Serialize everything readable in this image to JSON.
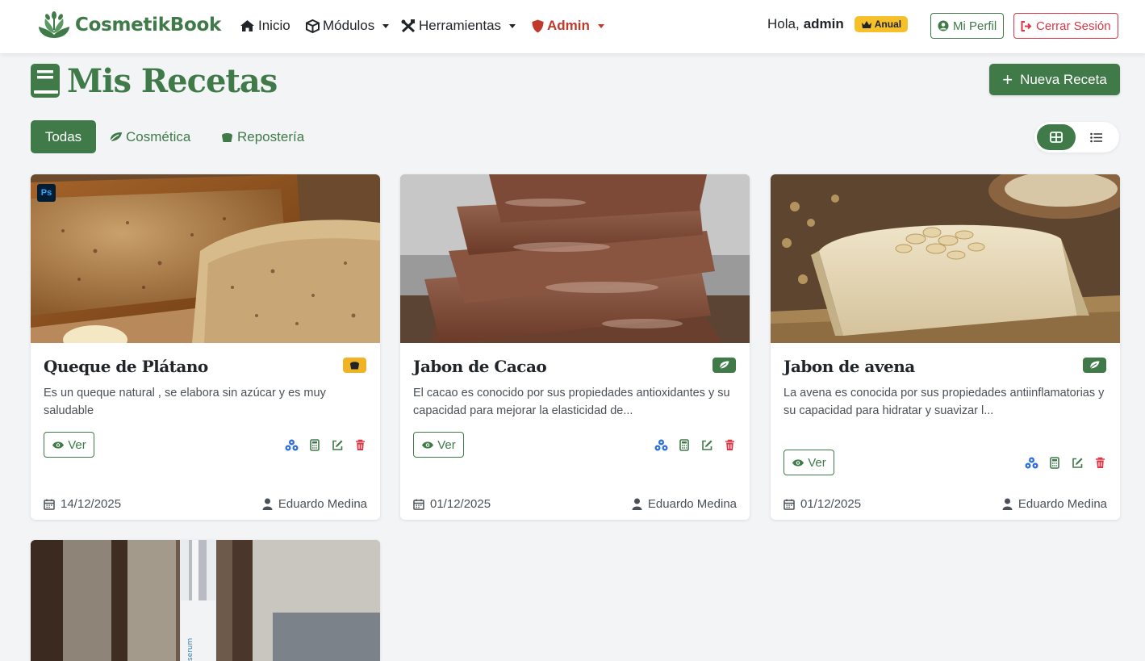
{
  "navbar": {
    "brand": "CosmetikBook",
    "items": [
      {
        "label": "Inicio",
        "icon": "home-icon"
      },
      {
        "label": "Módulos",
        "icon": "cube-icon"
      },
      {
        "label": "Herramientas",
        "icon": "tools-icon"
      },
      {
        "label": "Admin",
        "icon": "shield-icon"
      }
    ],
    "greeting": "Hola,",
    "username": "admin",
    "plan": "Anual",
    "profile_label": "Mi Perfil",
    "logout_label": "Cerrar Sesión"
  },
  "page": {
    "title": "Mis Recetas",
    "new_button": "Nueva Receta",
    "filters": [
      "Todas",
      "Cosmética",
      "Repostería"
    ]
  },
  "cards": [
    {
      "title": "Queque de Plátano",
      "category": "Repostería",
      "desc": "Es un queque natural , se elabora sin azúcar y es muy saludable",
      "view_label": "Ver",
      "date": "14/12/2025",
      "author": "Eduardo Medina",
      "image": "banana-bread"
    },
    {
      "title": "Jabon de Cacao",
      "category": "Cosmética",
      "desc": "El cacao es conocido por sus propiedades antioxidantes y su capacidad para mejorar la elasticidad de...",
      "view_label": "Ver",
      "date": "01/12/2025",
      "author": "Eduardo Medina",
      "image": "cacao-soap"
    },
    {
      "title": "Jabon de avena",
      "category": "Cosmética",
      "desc": "La avena es conocida por sus propiedades antiinflamatorias y su capacidad para hidratar y suavizar l...",
      "view_label": "Ver",
      "date": "01/12/2025",
      "author": "Eduardo Medina",
      "image": "oat-soap"
    }
  ],
  "colors": {
    "brand": "#3f7a48",
    "danger": "#dc3545",
    "warning": "#f0b323",
    "info": "#2f6fdb"
  }
}
